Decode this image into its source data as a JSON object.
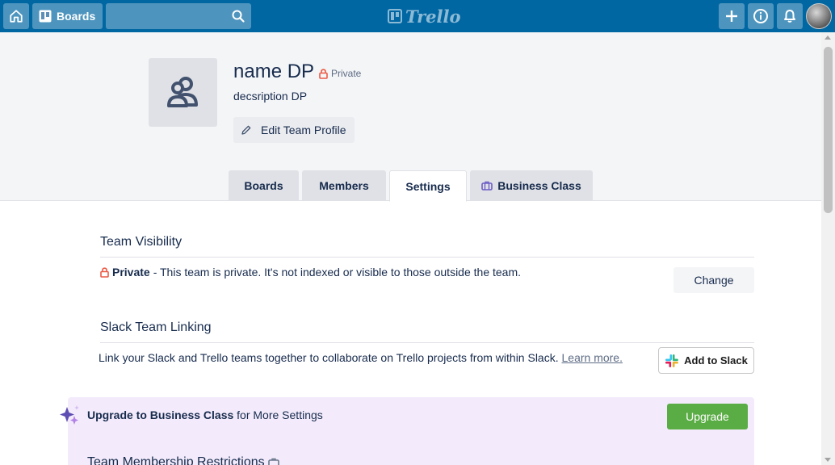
{
  "header": {
    "boards_label": "Boards",
    "search_value": "",
    "logo_text": "Trello"
  },
  "team": {
    "name": "name DP",
    "privacy_label": "Private",
    "description": "decsription DP",
    "edit_profile_label": "Edit Team Profile"
  },
  "tabs": [
    {
      "label": "Boards"
    },
    {
      "label": "Members"
    },
    {
      "label": "Settings"
    },
    {
      "label": "Business Class"
    }
  ],
  "settings": {
    "visibility": {
      "title": "Team Visibility",
      "status": "Private",
      "description": "- This team is private. It's not indexed or visible to those outside the team.",
      "change_label": "Change"
    },
    "slack": {
      "title": "Slack Team Linking",
      "description": "Link your Slack and Trello teams together to collaborate on Trello projects from within Slack.",
      "learn_more": "Learn more.",
      "button_label": "Add to Slack"
    },
    "upgrade": {
      "bold_text": "Upgrade to Business Class",
      "rest_text": " for More Settings",
      "button_label": "Upgrade",
      "next_section_title": "Team Membership Restrictions"
    }
  },
  "colors": {
    "header_bg": "#0067a3",
    "private_red": "#eb5a46",
    "upgrade_green": "#5aac44",
    "upgrade_panel_bg": "#f3ebfb",
    "business_purple": "#6e5dc6"
  }
}
